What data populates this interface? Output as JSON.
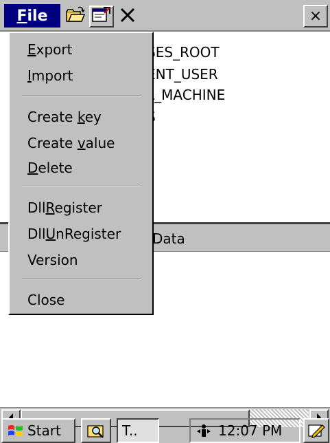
{
  "menubar": {
    "file_label_first": "F",
    "file_label_rest": "ile",
    "close_symbol": "×"
  },
  "tree": {
    "items": [
      "SES_ROOT",
      "ENT_USER",
      "L_MACHINE",
      "S"
    ]
  },
  "list": {
    "column_data": "Data"
  },
  "file_menu": {
    "export": {
      "u": "E",
      "rest": "xport"
    },
    "import": {
      "u": "I",
      "rest": "mport"
    },
    "create_key": {
      "pre": "Create ",
      "u": "k",
      "rest": "ey"
    },
    "create_value": {
      "pre": "Create ",
      "u": "v",
      "rest": "alue"
    },
    "delete": {
      "u": "D",
      "rest": "elete"
    },
    "dllregister": {
      "pre": "Dll",
      "u": "R",
      "rest": "egister"
    },
    "dllunregister": {
      "pre": "Dll",
      "u": "U",
      "rest": "nRegister"
    },
    "version": "Version",
    "close": "Close"
  },
  "taskbar": {
    "start_label": "Start",
    "task_label": "T..",
    "clock": "12:07 PM"
  },
  "icons": {
    "open": "open-folder-icon",
    "properties": "properties-icon",
    "delete": "delete-x-icon"
  }
}
